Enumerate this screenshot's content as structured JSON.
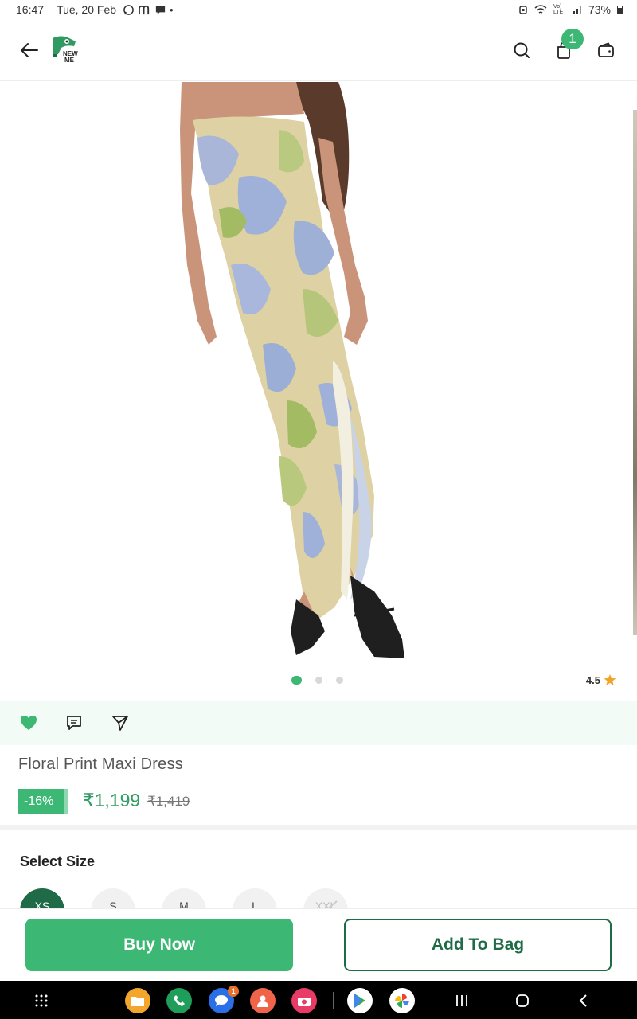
{
  "status_bar": {
    "time": "16:47",
    "date": "Tue, 20 Feb",
    "dot": "•",
    "battery": "73%",
    "network_label": "Vo) LTE"
  },
  "header": {
    "logo_text": "NEW ME",
    "cart_count": "1",
    "brand_color": "#3db874"
  },
  "gallery": {
    "total_images": 3,
    "active_index": 0,
    "rating": "4.5"
  },
  "product": {
    "title": "Floral Print Maxi Dress",
    "discount": "-16%",
    "price": "₹1,199",
    "mrp": "₹1,419"
  },
  "size_section": {
    "label": "Select Size",
    "sizes": [
      "XS",
      "S",
      "M",
      "L",
      "XXL"
    ],
    "selected": "XS",
    "disabled": [
      "XXL"
    ]
  },
  "actions": {
    "buy_now": "Buy Now",
    "add_to_bag": "Add To Bag"
  },
  "dock": {
    "messages_badge": "1"
  }
}
